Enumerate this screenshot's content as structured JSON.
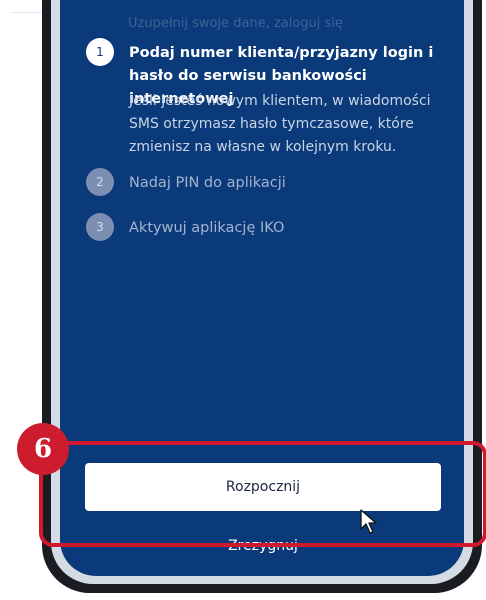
{
  "faded_step_text": "Uzupełnij swoje dane, zaloguj się",
  "steps": [
    {
      "number": "1",
      "title": "Podaj numer klienta/przyjazny login i hasło do serwisu bankowości internetowej",
      "description": "Jeśli jesteś nowym klientem, w wiadomości SMS otrzymasz hasło tymczasowe, które zmienisz na własne w kolejnym kroku.",
      "active": true
    },
    {
      "number": "2",
      "title": "Nadaj PIN do aplikacji",
      "active": false
    },
    {
      "number": "3",
      "title": "Aktywuj aplikację IKO",
      "active": false
    }
  ],
  "start_button_label": "Rozpocznij",
  "cancel_link_label": "Zrezygnuj",
  "annotation": {
    "badge_number": "6",
    "color": "#cc1c2e"
  },
  "colors": {
    "screen_background": "#0a3a7a",
    "button_background": "#ffffff"
  }
}
